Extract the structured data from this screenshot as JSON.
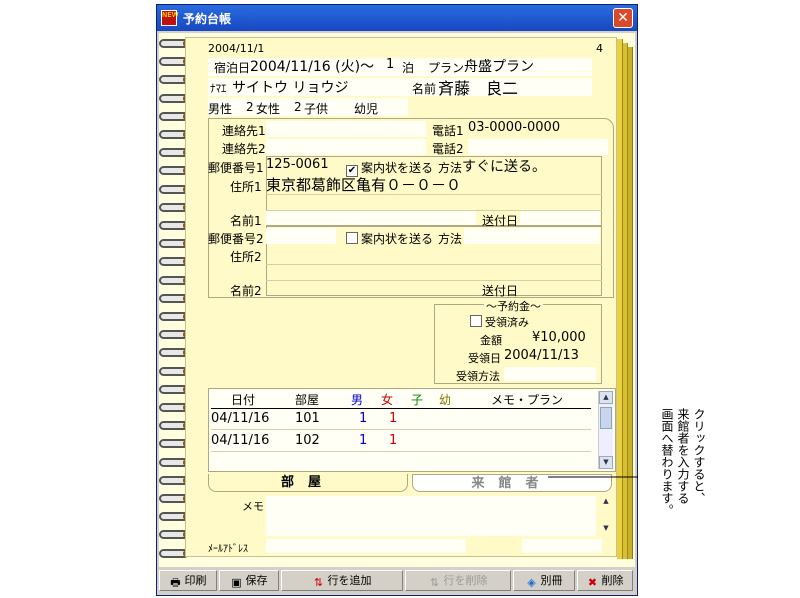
{
  "window": {
    "title": "予約台帳",
    "app_icon_text": "NEW"
  },
  "header": {
    "date": "2004/11/1",
    "page_number": "4",
    "stay_date_label": "宿泊日",
    "stay_date_value": "2004/11/16 (火)～",
    "nights_value": "1",
    "nights_label": "泊",
    "plan_label": "プラン",
    "plan_value": "舟盛プラン",
    "kana_label": "ﾅﾏｴ",
    "kana_value": "サイトウ リョウジ",
    "name_label": "名前",
    "name_value": "斉藤　良二",
    "male_label": "男性",
    "male_value": "2",
    "female_label": "女性",
    "female_value": "2",
    "child_label": "子供",
    "infant_label": "幼児"
  },
  "contact": {
    "contact1_label": "連絡先1",
    "contact2_label": "連絡先2",
    "phone1_label": "電話1",
    "phone1_value": "03-0000-0000",
    "phone2_label": "電話2",
    "postal1_label": "郵便番号1",
    "postal1_value": "125-0061",
    "invite1_label": "案内状を送る",
    "method1_label": "方法",
    "method1_value": "すぐに送る。",
    "address1_label": "住所1",
    "address1_value": "東京都葛飾区亀有０－０－０",
    "name1_label": "名前1",
    "sent1_label": "送付日",
    "postal2_label": "郵便番号2",
    "invite2_label": "案内状を送る",
    "method2_label": "方法",
    "address2_label": "住所2",
    "name2_label": "名前2",
    "sent2_label": "送付日"
  },
  "deposit": {
    "group_title": "～予約金～",
    "received_check_label": "受領済み",
    "received_checked": false,
    "amount_label": "金額",
    "amount_value": "¥10,000",
    "received_date_label": "受領日",
    "received_date_value": "2004/11/13",
    "method_label": "受領方法"
  },
  "rooms_table": {
    "columns": [
      "日付",
      "部屋",
      "男",
      "女",
      "子",
      "幼",
      "メモ・プラン"
    ],
    "rows": [
      {
        "date": "04/11/16",
        "room": "101",
        "male": "1",
        "female": "1",
        "child": "",
        "infant": "",
        "memo": ""
      },
      {
        "date": "04/11/16",
        "room": "102",
        "male": "1",
        "female": "1",
        "child": "",
        "infant": "",
        "memo": ""
      }
    ]
  },
  "tabs": {
    "rooms": "部屋",
    "guests": "来館者"
  },
  "memo_label": "メモ",
  "email_label": "ﾒｰﾙｱﾄﾞﾚｽ",
  "toolbar": {
    "print": "印刷",
    "save": "保存",
    "add_row": "行を追加",
    "delete_row": "行を削除",
    "other_form": "別冊",
    "delete": "削除"
  },
  "callout": {
    "lines": [
      "クリックすると、",
      "来館者を入力する",
      "画面へ替わります。"
    ]
  },
  "colors": {
    "title_bar": "#1f5ad6",
    "page_bg": "#fffac8",
    "male_col": "#0000cc",
    "female_col": "#cc0000",
    "child_col": "#008800",
    "infant_col": "#887700"
  }
}
